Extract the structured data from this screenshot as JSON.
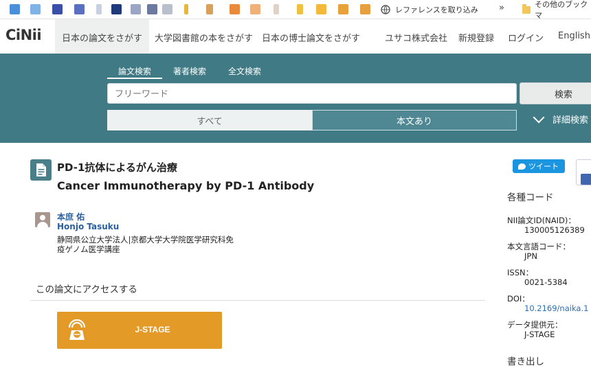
{
  "bookmarks": {
    "readinglist_label": "レファレンスを取り込み",
    "chevron": "»",
    "other_label": "その他のブックマ"
  },
  "nav": {
    "logo": "CiNii",
    "links": [
      "日本の論文をさがす",
      "大学図書館の本をさがす",
      "日本の博士論文をさがす"
    ],
    "org": "ユサコ株式会社",
    "register": "新規登録",
    "login": "ログイン",
    "lang": "English"
  },
  "search": {
    "tabs": [
      "論文検索",
      "著者検索",
      "全文検索"
    ],
    "placeholder": "フリーワード",
    "button": "検索",
    "seg_all": "すべて",
    "seg_fulltext": "本文あり",
    "advanced": "詳細検索"
  },
  "article": {
    "title_ja": "PD-1抗体によるがん治療",
    "title_en": "Cancer Immunotherapy by PD-1 Antibody",
    "author_ja": "本庶 佑",
    "author_en": "Honjo Tasuku",
    "affil_line1": "静岡県公立大学法人|京都大学大学院医学研究科免",
    "affil_line2": "疫ゲノム医学講座",
    "access_heading": "この論文にアクセスする",
    "jstage_label": "J-STAGE"
  },
  "sidebar": {
    "tweet": "ツイート",
    "codes_heading": "各種コード",
    "naid_label": "NII論文ID(NAID)：",
    "naid_value": "130005126389",
    "lang_label": "本文言語コード：",
    "lang_value": "JPN",
    "issn_label": "ISSN：",
    "issn_value": "0021-5384",
    "doi_label": "DOI：",
    "doi_value": "10.2169/naika.1",
    "provider_label": "データ提供元：",
    "provider_value": "J-STAGE",
    "export_heading": "書き出し"
  },
  "colors": {
    "band": "#3f7a85",
    "jstage": "#e39a27",
    "link": "#2a5f9e",
    "tweet": "#1b95e0"
  }
}
